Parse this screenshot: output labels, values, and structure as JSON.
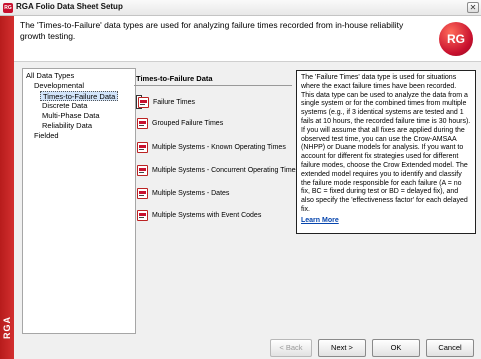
{
  "window": {
    "title": "RGA Folio Data Sheet Setup",
    "close_glyph": "✕"
  },
  "header": {
    "text": "The 'Times-to-Failure' data types are used for analyzing failure times recorded from in-house reliability growth testing.",
    "logo_text": "RG"
  },
  "brand_band": {
    "text": "RGA",
    "color": "#c8102e"
  },
  "tree": {
    "items": [
      {
        "label": "All Data Types"
      },
      {
        "label": "Developmental"
      },
      {
        "label": "Times-to-Failure Data"
      },
      {
        "label": "Discrete Data"
      },
      {
        "label": "Multi-Phase Data"
      },
      {
        "label": "Reliability Data"
      },
      {
        "label": "Fielded"
      }
    ],
    "selected": "Times-to-Failure Data"
  },
  "panel": {
    "title": "Times-to-Failure Data",
    "options": [
      {
        "label": "Failure Times",
        "icon": "data-sheet-icon"
      },
      {
        "label": "Grouped Failure Times",
        "icon": "data-sheet-icon"
      },
      {
        "label": "Multiple Systems - Known Operating Times",
        "icon": "data-sheet-icon"
      },
      {
        "label": "Multiple Systems - Concurrent Operating Times",
        "icon": "data-sheet-icon"
      },
      {
        "label": "Multiple Systems - Dates",
        "icon": "data-sheet-icon"
      },
      {
        "label": "Multiple Systems with Event Codes",
        "icon": "data-sheet-icon"
      }
    ],
    "selected": "Failure Times"
  },
  "description": {
    "text": "The 'Failure Times' data type is used for situations where the exact failure times have been recorded. This data type can be used to analyze the data from a single system or for the combined times from multiple systems (e.g., if 3 identical systems are tested and 1 fails at 10 hours, the recorded failure time is 30 hours). If you will assume that all fixes are applied during the observed test time, you can use the Crow-AMSAA (NHPP) or Duane models for analysis. If you want to account for different fix strategies used for different failure modes, choose the Crow Extended model. The extended model requires you to identify and classify the failure mode responsible for each failure (A = no fix, BC = fixed during test or BD = delayed fix), and also specify the 'effectiveness factor' for each delayed fix.",
    "link": "Learn More"
  },
  "footer": {
    "back": "< Back",
    "next": "Next >",
    "ok": "OK",
    "cancel": "Cancel"
  }
}
